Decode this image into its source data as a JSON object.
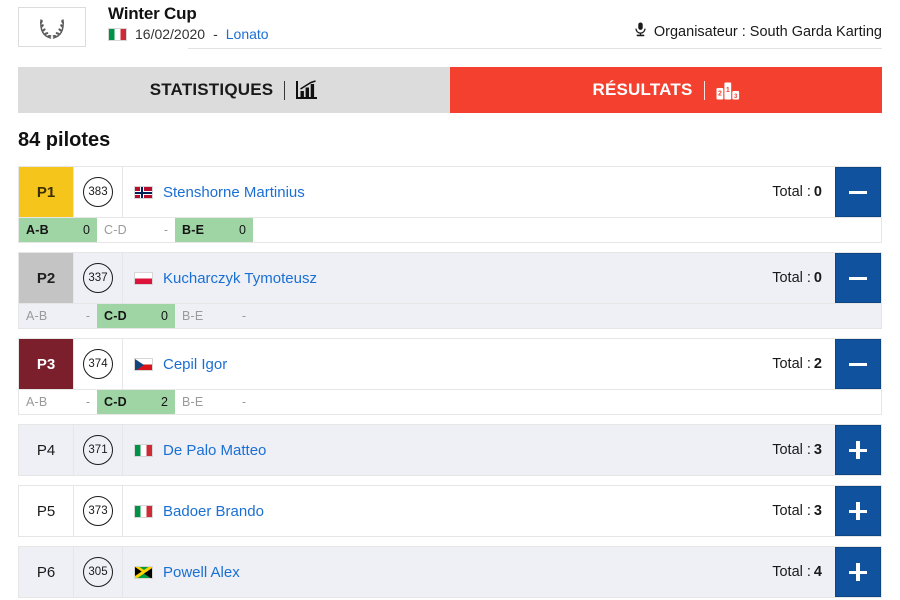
{
  "header": {
    "logo_icon": "laurel-wreath-icon",
    "event_title": "Winter Cup",
    "event_date": "16/02/2020",
    "event_separator": "-",
    "event_city": "Lonato",
    "event_country_flag": "flag-italy",
    "organiser_icon": "microphone-icon",
    "organiser_text": "Organisateur : South Garda Karting"
  },
  "tabs": [
    {
      "label": "STATISTIQUES",
      "icon": "bar-chart-icon",
      "active": false
    },
    {
      "label": "RÉSULTATS",
      "icon": "podium-icon",
      "active": true
    }
  ],
  "main": {
    "pilot_count_label": "84 pilotes",
    "total_prefix": "Total :",
    "rows": [
      {
        "position": "P1",
        "badge_style": "gold",
        "number": "383",
        "flag": "flag-norway",
        "name": "Stenshorne Martinius",
        "total": "0",
        "action": "minus",
        "alt": false,
        "sessions": [
          {
            "key": "A-B",
            "value": "0",
            "highlight": true
          },
          {
            "key": "C-D",
            "value": "-",
            "highlight": false
          },
          {
            "key": "B-E",
            "value": "0",
            "highlight": true
          }
        ]
      },
      {
        "position": "P2",
        "badge_style": "silver",
        "number": "337",
        "flag": "flag-poland",
        "name": "Kucharczyk Tymoteusz",
        "total": "0",
        "action": "minus",
        "alt": true,
        "sessions": [
          {
            "key": "A-B",
            "value": "-",
            "highlight": false
          },
          {
            "key": "C-D",
            "value": "0",
            "highlight": true
          },
          {
            "key": "B-E",
            "value": "-",
            "highlight": false
          }
        ]
      },
      {
        "position": "P3",
        "badge_style": "bronze",
        "number": "374",
        "flag": "flag-czech",
        "name": "Cepil Igor",
        "total": "2",
        "action": "minus",
        "alt": false,
        "sessions": [
          {
            "key": "A-B",
            "value": "-",
            "highlight": false
          },
          {
            "key": "C-D",
            "value": "2",
            "highlight": true
          },
          {
            "key": "B-E",
            "value": "-",
            "highlight": false
          }
        ]
      },
      {
        "position": "P4",
        "badge_style": "plain",
        "number": "371",
        "flag": "flag-italy",
        "name": "De Palo Matteo",
        "total": "3",
        "action": "plus",
        "alt": true,
        "sessions": []
      },
      {
        "position": "P5",
        "badge_style": "plain",
        "number": "373",
        "flag": "flag-italy",
        "name": "Badoer Brando",
        "total": "3",
        "action": "plus",
        "alt": false,
        "sessions": []
      },
      {
        "position": "P6",
        "badge_style": "plain",
        "number": "305",
        "flag": "flag-jamaica",
        "name": "Powell Alex",
        "total": "4",
        "action": "plus",
        "alt": true,
        "sessions": []
      }
    ]
  },
  "colors": {
    "accent_red": "#f4402f",
    "tab_inactive": "#dcdcdc",
    "action_blue": "#10529e",
    "link_blue": "#1a6fd4",
    "gold": "#f5c51c",
    "silver": "#c4c4c4",
    "bronze": "#7a1f2b",
    "session_green": "#9fd5a4",
    "row_alt": "#eef0f6"
  }
}
